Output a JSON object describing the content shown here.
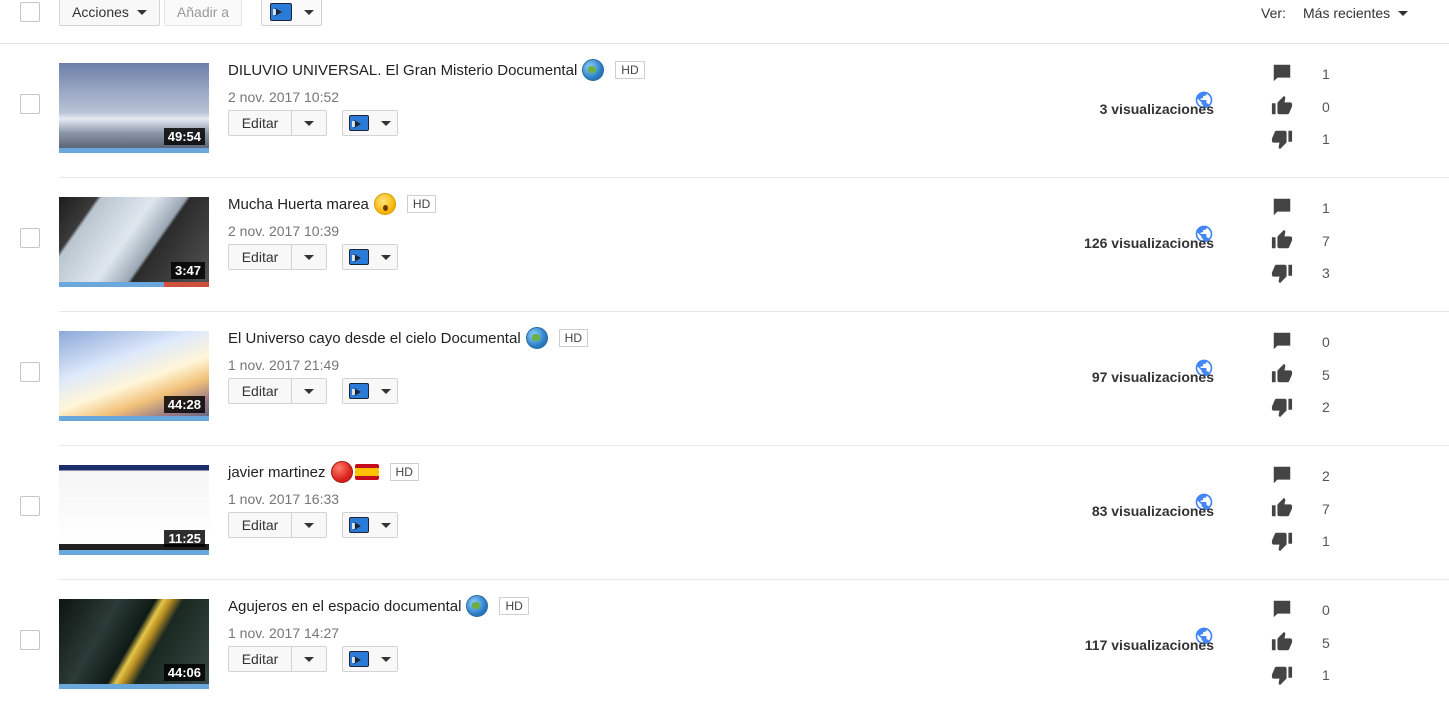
{
  "toolbar": {
    "actions_label": "Acciones",
    "add_to_label": "Añadir a",
    "view_label": "Ver:",
    "sort_value": "Más recientes"
  },
  "colors": {
    "progress_blue": "#6aa7dc",
    "progress_red": "#d0503b",
    "globe_blue": "#4285f4",
    "icon_gray": "#444444"
  },
  "videos": [
    {
      "title": "DILUVIO UNIVERSAL. El Gran Misterio Documental",
      "emoji": "globe",
      "hd": "HD",
      "date": "2 nov. 2017 10:52",
      "duration": "49:54",
      "edit_label": "Editar",
      "views": "3 visualizaciones",
      "comments": "1",
      "likes": "0",
      "dislikes": "1",
      "red_progress": 0
    },
    {
      "title": "Mucha Huerta marea",
      "emoji": "astonished-face",
      "hd": "HD",
      "date": "2 nov. 2017 10:39",
      "duration": "3:47",
      "edit_label": "Editar",
      "views": "126 visualizaciones",
      "comments": "1",
      "likes": "7",
      "dislikes": "3",
      "red_progress": 0.3
    },
    {
      "title": "El Universo cayo desde el cielo Documental",
      "emoji": "globe",
      "hd": "HD",
      "date": "1 nov. 2017 21:49",
      "duration": "44:28",
      "edit_label": "Editar",
      "views": "97 visualizaciones",
      "comments": "0",
      "likes": "5",
      "dislikes": "2",
      "red_progress": 0
    },
    {
      "title": "javier martinez",
      "emoji": "red-circle-spain-flag",
      "hd": "HD",
      "date": "1 nov. 2017 16:33",
      "duration": "11:25",
      "edit_label": "Editar",
      "views": "83 visualizaciones",
      "comments": "2",
      "likes": "7",
      "dislikes": "1",
      "red_progress": 0
    },
    {
      "title": "Agujeros en el espacio documental",
      "emoji": "globe",
      "hd": "HD",
      "date": "1 nov. 2017 14:27",
      "duration": "44:06",
      "edit_label": "Editar",
      "views": "117 visualizaciones",
      "comments": "0",
      "likes": "5",
      "dislikes": "1",
      "red_progress": 0
    }
  ]
}
